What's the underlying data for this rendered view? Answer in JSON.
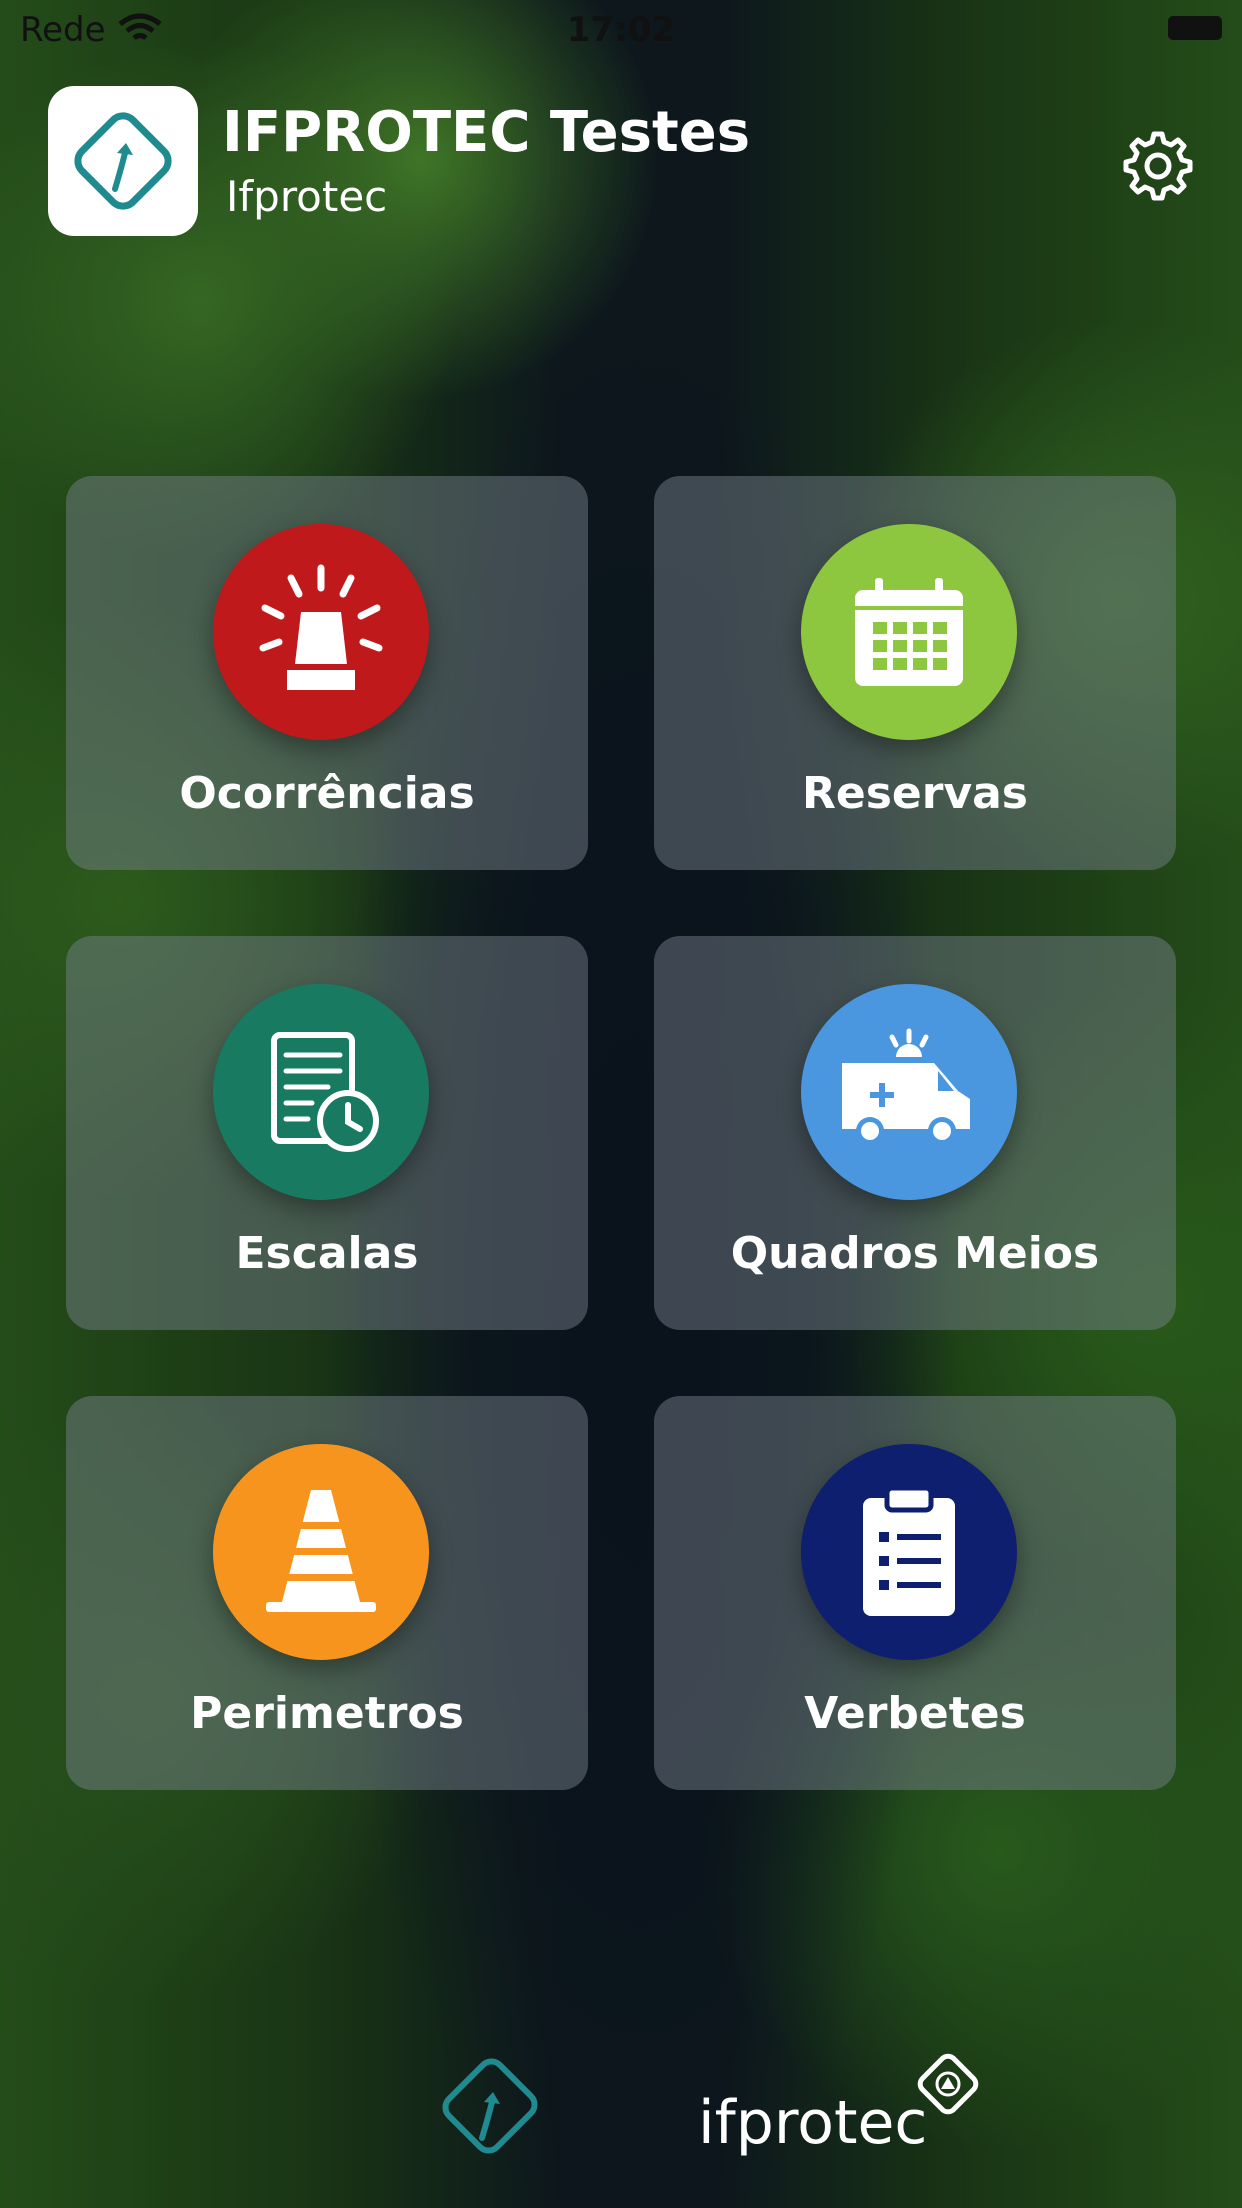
{
  "status_bar": {
    "carrier": "Rede",
    "time": "17:02"
  },
  "header": {
    "title": "IFPROTEC Testes",
    "subtitle": "Ifprotec"
  },
  "tiles": [
    {
      "label": "Ocorrências",
      "icon": "alarm-light-icon",
      "color": "#c0191b"
    },
    {
      "label": "Reservas",
      "icon": "calendar-icon",
      "color": "#8dc63f"
    },
    {
      "label": "Escalas",
      "icon": "schedule-document-clock-icon",
      "color": "#197a62"
    },
    {
      "label": "Quadros Meios",
      "icon": "ambulance-icon",
      "color": "#4a97e0"
    },
    {
      "label": "Perimetros",
      "icon": "traffic-cone-icon",
      "color": "#f7941d"
    },
    {
      "label": "Verbetes",
      "icon": "clipboard-list-icon",
      "color": "#0d1f6e"
    }
  ],
  "footer": {
    "brand": "ifprotec"
  },
  "colors": {
    "accent_teal": "#1f8a8f"
  }
}
